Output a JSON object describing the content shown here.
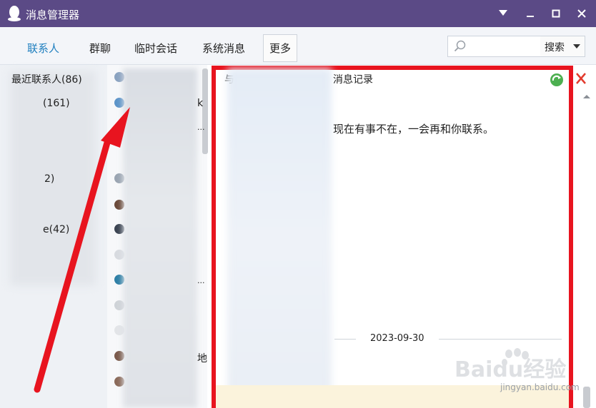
{
  "window": {
    "title": "消息管理器"
  },
  "tabs": [
    {
      "label": "联系人",
      "active": true
    },
    {
      "label": "群聊"
    },
    {
      "label": "临时会话"
    },
    {
      "label": "系统消息"
    },
    {
      "label": "更多"
    }
  ],
  "search": {
    "value": "",
    "button_label": "搜索"
  },
  "left_panel": {
    "items": [
      {
        "label": "最近联系人(86)"
      },
      {
        "label": "(161)"
      },
      {
        "label": "2)"
      },
      {
        "label": "e(42)"
      }
    ]
  },
  "middle_panel": {
    "fragments": [
      "k",
      "...",
      "...",
      "地"
    ]
  },
  "message_pane": {
    "header_fragment": "与",
    "history_label": "消息记录",
    "message_text": "现在有事不在，一会再和你联系。",
    "date_divider": "2023-09-30"
  },
  "watermark": {
    "brand": "Baidu经验",
    "url": "jingyan.baidu.com"
  },
  "colors": {
    "titlebar": "#5b4a86",
    "accent_tab": "#1f7fbf",
    "highlight_border": "#e8141f",
    "annotation_arrow": "#e8141f"
  }
}
